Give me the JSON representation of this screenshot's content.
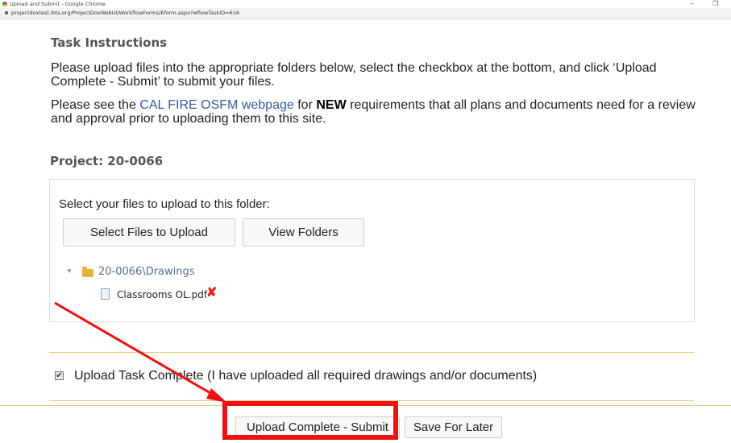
{
  "window": {
    "title": "Upload and Submit - Google Chrome",
    "url": "projectdoxtest.ibts.org/ProjectDoxWebUI/WorkflowForms/Eform.aspx?wflowTaskID=616",
    "minimize_glyph": "–",
    "restore_glyph": "❐"
  },
  "instructions": {
    "heading": "Task Instructions",
    "para1": "Please upload files into the appropriate folders below, select the checkbox at the bottom, and click ‘Upload Complete - Submit’ to submit your files.",
    "para2_prefix": "Please see the ",
    "para2_link": "CAL FIRE OSFM webpage",
    "para2_mid": " for ",
    "para2_bold": "NEW",
    "para2_suffix": " requirements that all plans and documents need for a review and approval prior to uploading them to this site."
  },
  "project": {
    "heading": "Project: 20-0066"
  },
  "upload": {
    "label": "Select your files to upload to this folder:",
    "select_button": "Select Files to Upload",
    "view_button": "View Folders",
    "folder": "20-0066\\Drawings",
    "file": "Classrooms OL.pdf",
    "remove_glyph": "✘"
  },
  "completion": {
    "checked": true,
    "check_glyph": "✔",
    "label": "Upload Task Complete (I have uploaded all required drawings and/or documents)"
  },
  "actions": {
    "submit": "Upload Complete - Submit",
    "save": "Save For Later"
  },
  "colors": {
    "annotation": "#ee1111",
    "link": "#3a5a9a",
    "rule": "#e5c97a"
  }
}
